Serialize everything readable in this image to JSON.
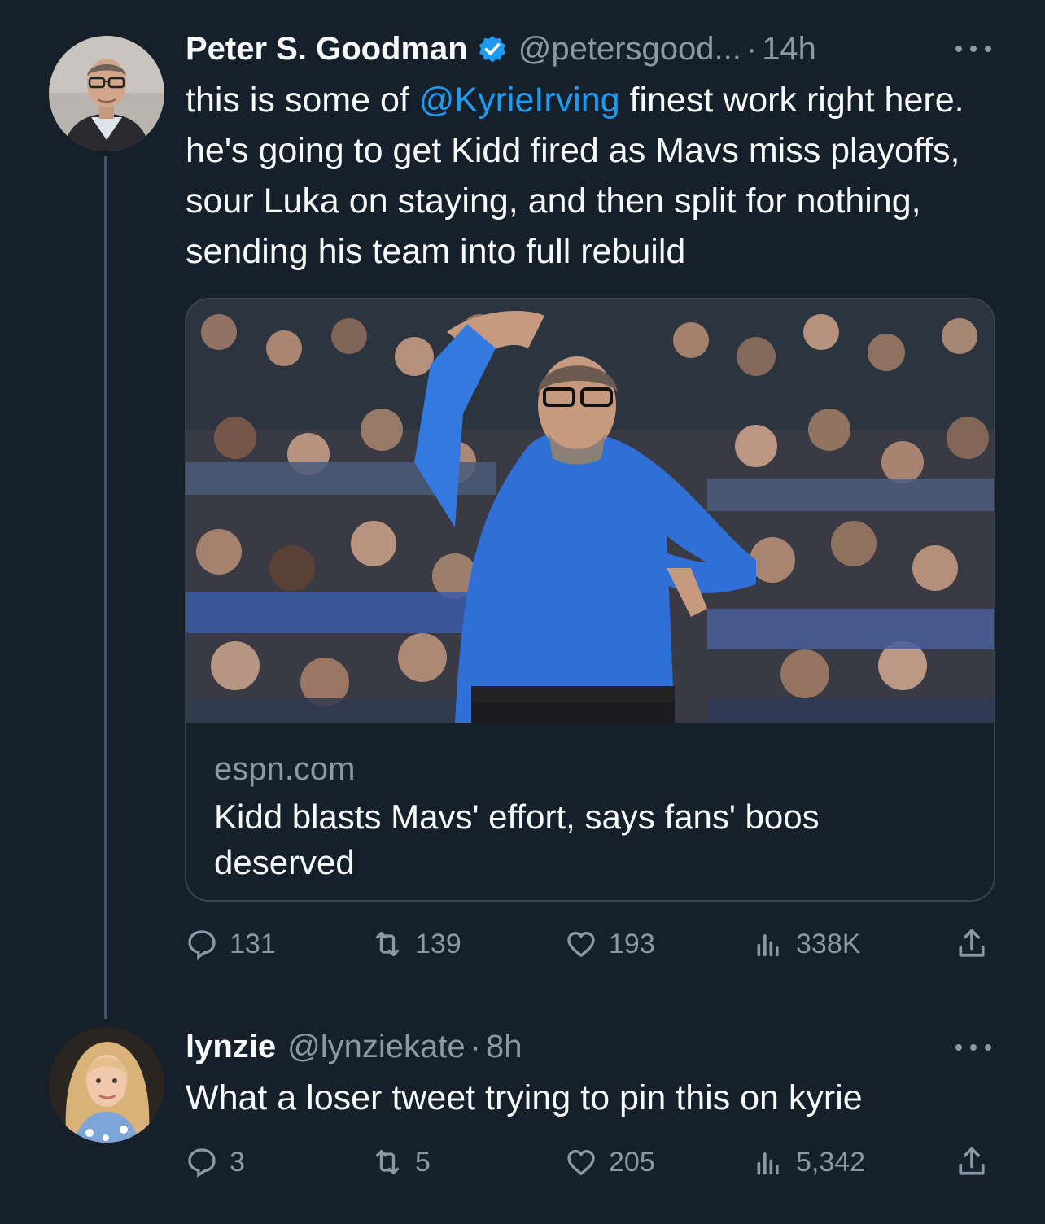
{
  "tweets": [
    {
      "author": {
        "name": "Peter S. Goodman",
        "handle": "@petersgood...",
        "verified": true
      },
      "time": "14h",
      "text_parts": {
        "before": "this is some of ",
        "mention": "@KyrieIrving",
        "after": " finest work right here. he's going to get Kidd fired as Mavs miss playoffs, sour Luka on staying, and then split for nothing, sending his team into full rebuild"
      },
      "card": {
        "domain": "espn.com",
        "title": "Kidd blasts Mavs' effort, says fans' boos deserved"
      },
      "stats": {
        "replies": "131",
        "retweets": "139",
        "likes": "193",
        "views": "338K"
      }
    },
    {
      "author": {
        "name": "lynzie",
        "handle": "@lynziekate"
      },
      "time": "8h",
      "text": "What a loser tweet trying to pin this on kyrie",
      "stats": {
        "replies": "3",
        "retweets": "5",
        "likes": "205",
        "views": "5,342"
      }
    }
  ],
  "icons": {
    "reply": "reply-icon",
    "retweet": "retweet-icon",
    "like": "heart-icon",
    "views": "views-icon",
    "share": "share-icon",
    "more": "more-icon",
    "verified": "verified-badge-icon"
  },
  "colors": {
    "background": "#15202b",
    "text": "#f7f9f9",
    "muted": "#8b98a5",
    "accent": "#1d9bf0",
    "border": "#38444d"
  }
}
